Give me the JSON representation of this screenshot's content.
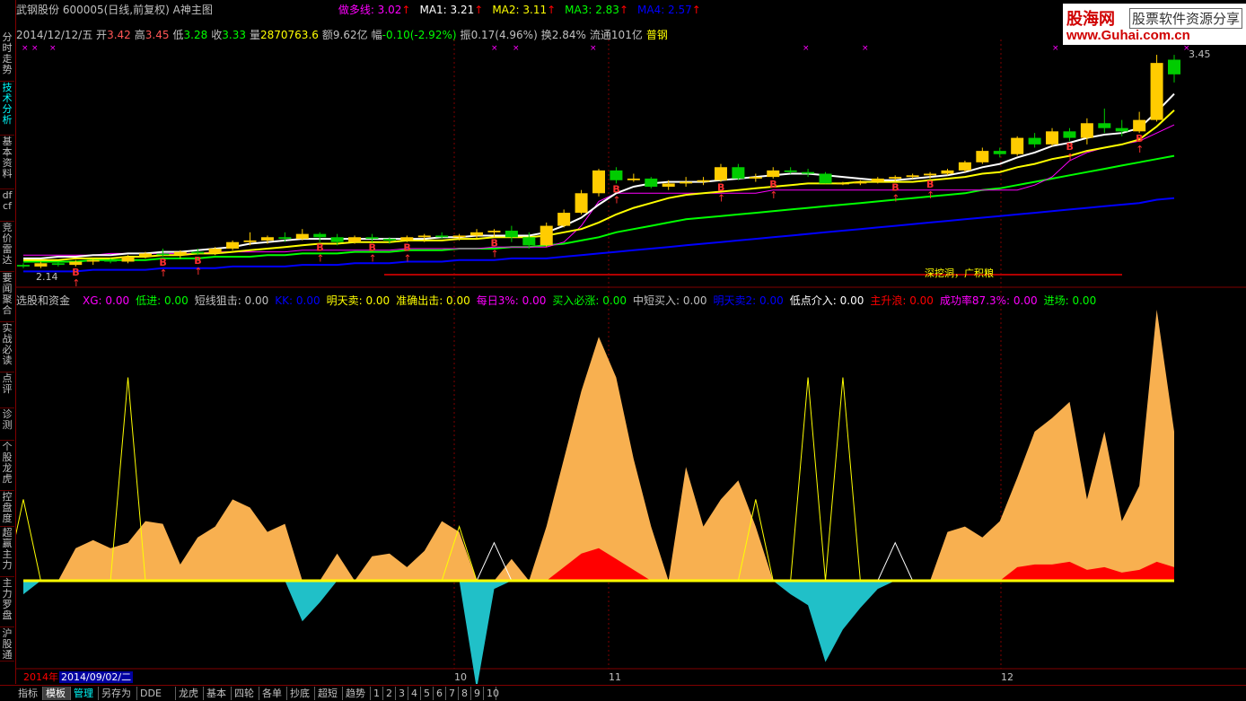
{
  "header": {
    "stock_title": "武钢股份 600005(日线,前复权) A神主图",
    "ma_labels": [
      {
        "text": "做多线: 3.02",
        "color": "#ff00ff"
      },
      {
        "text": "MA1: 3.21",
        "color": "#ffffff"
      },
      {
        "text": "MA2: 3.11",
        "color": "#ffff00"
      },
      {
        "text": "MA3: 2.83",
        "color": "#00ff00"
      },
      {
        "text": "MA4: 2.57",
        "color": "#0000ff"
      }
    ],
    "arrow": "↑"
  },
  "info": {
    "date": "2014/12/12/五",
    "open_label": "开",
    "open": "3.42",
    "high_label": "高",
    "high": "3.45",
    "low_label": "低",
    "low": "3.28",
    "close_label": "收",
    "close": "3.33",
    "volume_label": "量",
    "volume": "2870763.6",
    "amount_label": "额",
    "amount": "9.62亿",
    "change_label": "幅",
    "change": "-0.10(-2.92%)",
    "amp_label": "振",
    "amp": "0.17(4.96%)",
    "turn_label": "换",
    "turn": "2.84%",
    "float_label": "流通",
    "float": "101亿",
    "sector": "普钢"
  },
  "logo": {
    "brand": "股海网",
    "slogan": "股票软件资源分享",
    "url": "www.Guhai.com.cn"
  },
  "sidebar": [
    {
      "label": "分时走势",
      "active": false
    },
    {
      "label": "技术分析",
      "active": true
    },
    {
      "label": "基本资料",
      "active": false
    },
    {
      "label": "dfcf",
      "active": false
    },
    {
      "label": "竞价雷达",
      "active": false
    },
    {
      "label": "要闻聚合",
      "active": false
    },
    {
      "label": "实战必读",
      "active": false
    },
    {
      "label": "点评",
      "active": false
    },
    {
      "label": "诊测",
      "active": false
    },
    {
      "label": "个股龙虎",
      "active": false
    },
    {
      "label": "控盘度",
      "active": false
    },
    {
      "label": "超赢主力",
      "active": false
    },
    {
      "label": "主力罗盘",
      "active": false
    },
    {
      "label": "沪股通",
      "active": false
    }
  ],
  "indicator": {
    "name": "选股和资金",
    "items": [
      {
        "text": "XG: 0.00",
        "color": "#ff00ff"
      },
      {
        "text": "低进: 0.00",
        "color": "#00ff00"
      },
      {
        "text": "短线狙击: 0.00",
        "color": "#c0c0c0"
      },
      {
        "text": "KK: 0.00",
        "color": "#0000ff"
      },
      {
        "text": "明天卖: 0.00",
        "color": "#ffff00"
      },
      {
        "text": "准确出击: 0.00",
        "color": "#ffff00"
      },
      {
        "text": "每日3%: 0.00",
        "color": "#ff00ff"
      },
      {
        "text": "买入必涨: 0.00",
        "color": "#00ff00"
      },
      {
        "text": "中短买入: 0.00",
        "color": "#c0c0c0"
      },
      {
        "text": "明天卖2: 0.00",
        "color": "#0000ff"
      },
      {
        "text": "低点介入: 0.00",
        "color": "#ffffff"
      },
      {
        "text": "主升浪: 0.00",
        "color": "#ff0000"
      },
      {
        "text": "成功率87.3%: 0.00",
        "color": "#ff00ff"
      },
      {
        "text": "进场: 0.00",
        "color": "#00ff00"
      }
    ]
  },
  "annotations": {
    "price_high": "3.45",
    "price_low": "2.14",
    "banner": "深挖洞，广积粮",
    "buy_marker": "B"
  },
  "time_axis": {
    "year": "2014年",
    "cursor_date": "2014/09/02/二",
    "months": [
      "10",
      "11",
      "12"
    ]
  },
  "bottom_tabs": [
    {
      "label": "指标",
      "state": "normal"
    },
    {
      "label": "模板",
      "state": "active"
    },
    {
      "label": "管理",
      "state": "hl"
    },
    {
      "label": "另存为",
      "state": "normal"
    },
    {
      "label": "DDE",
      "state": "normal"
    },
    {
      "label": "龙虎",
      "state": "normal"
    },
    {
      "label": "基本",
      "state": "normal"
    },
    {
      "label": "四轮",
      "state": "normal"
    },
    {
      "label": "各单",
      "state": "normal"
    },
    {
      "label": "抄底",
      "state": "normal"
    },
    {
      "label": "超短",
      "state": "normal"
    },
    {
      "label": "趋势",
      "state": "normal"
    },
    {
      "label": "1",
      "state": "normal"
    },
    {
      "label": "2",
      "state": "normal"
    },
    {
      "label": "3",
      "state": "normal"
    },
    {
      "label": "4",
      "state": "normal"
    },
    {
      "label": "5",
      "state": "normal"
    },
    {
      "label": "6",
      "state": "normal"
    },
    {
      "label": "7",
      "state": "normal"
    },
    {
      "label": "8",
      "state": "normal"
    },
    {
      "label": "9",
      "state": "normal"
    },
    {
      "label": "10",
      "state": "normal"
    }
  ],
  "chart_data": {
    "type": "candlestick",
    "ylim": [
      2.1,
      3.5
    ],
    "candles": [
      [
        2.16,
        2.17,
        2.14,
        2.15
      ],
      [
        2.15,
        2.18,
        2.14,
        2.17
      ],
      [
        2.17,
        2.18,
        2.15,
        2.16
      ],
      [
        2.16,
        2.19,
        2.15,
        2.18
      ],
      [
        2.18,
        2.2,
        2.16,
        2.19
      ],
      [
        2.19,
        2.2,
        2.17,
        2.18
      ],
      [
        2.18,
        2.22,
        2.17,
        2.21
      ],
      [
        2.21,
        2.24,
        2.2,
        2.23
      ],
      [
        2.23,
        2.26,
        2.21,
        2.22
      ],
      [
        2.22,
        2.25,
        2.2,
        2.24
      ],
      [
        2.24,
        2.26,
        2.22,
        2.23
      ],
      [
        2.23,
        2.27,
        2.22,
        2.26
      ],
      [
        2.26,
        2.31,
        2.25,
        2.3
      ],
      [
        2.3,
        2.36,
        2.28,
        2.31
      ],
      [
        2.31,
        2.34,
        2.29,
        2.33
      ],
      [
        2.33,
        2.36,
        2.3,
        2.32
      ],
      [
        2.32,
        2.38,
        2.31,
        2.35
      ],
      [
        2.35,
        2.36,
        2.3,
        2.33
      ],
      [
        2.33,
        2.35,
        2.28,
        2.3
      ],
      [
        2.3,
        2.34,
        2.29,
        2.33
      ],
      [
        2.33,
        2.35,
        2.3,
        2.32
      ],
      [
        2.32,
        2.33,
        2.29,
        2.31
      ],
      [
        2.31,
        2.34,
        2.3,
        2.33
      ],
      [
        2.33,
        2.35,
        2.3,
        2.34
      ],
      [
        2.34,
        2.36,
        2.32,
        2.33
      ],
      [
        2.33,
        2.35,
        2.31,
        2.34
      ],
      [
        2.34,
        2.38,
        2.32,
        2.36
      ],
      [
        2.36,
        2.38,
        2.33,
        2.37
      ],
      [
        2.37,
        2.4,
        2.3,
        2.33
      ],
      [
        2.33,
        2.36,
        2.26,
        2.28
      ],
      [
        2.28,
        2.42,
        2.27,
        2.4
      ],
      [
        2.4,
        2.5,
        2.39,
        2.48
      ],
      [
        2.48,
        2.62,
        2.47,
        2.6
      ],
      [
        2.6,
        2.75,
        2.58,
        2.74
      ],
      [
        2.74,
        2.76,
        2.66,
        2.68
      ],
      [
        2.68,
        2.72,
        2.67,
        2.69
      ],
      [
        2.69,
        2.7,
        2.63,
        2.64
      ],
      [
        2.64,
        2.68,
        2.62,
        2.66
      ],
      [
        2.66,
        2.7,
        2.64,
        2.67
      ],
      [
        2.67,
        2.7,
        2.65,
        2.68
      ],
      [
        2.68,
        2.78,
        2.67,
        2.76
      ],
      [
        2.76,
        2.78,
        2.68,
        2.69
      ],
      [
        2.69,
        2.72,
        2.67,
        2.7
      ],
      [
        2.7,
        2.76,
        2.69,
        2.74
      ],
      [
        2.74,
        2.76,
        2.72,
        2.73
      ],
      [
        2.73,
        2.75,
        2.7,
        2.72
      ],
      [
        2.72,
        2.73,
        2.66,
        2.66
      ],
      [
        2.66,
        2.67,
        2.65,
        2.66
      ],
      [
        2.66,
        2.68,
        2.65,
        2.67
      ],
      [
        2.67,
        2.7,
        2.66,
        2.69
      ],
      [
        2.69,
        2.71,
        2.67,
        2.7
      ],
      [
        2.7,
        2.72,
        2.69,
        2.71
      ],
      [
        2.71,
        2.73,
        2.69,
        2.72
      ],
      [
        2.72,
        2.75,
        2.71,
        2.74
      ],
      [
        2.74,
        2.8,
        2.73,
        2.79
      ],
      [
        2.79,
        2.88,
        2.78,
        2.86
      ],
      [
        2.86,
        2.88,
        2.82,
        2.84
      ],
      [
        2.84,
        2.95,
        2.83,
        2.94
      ],
      [
        2.94,
        2.97,
        2.88,
        2.9
      ],
      [
        2.9,
        3.0,
        2.89,
        2.98
      ],
      [
        2.98,
        3.0,
        2.92,
        2.94
      ],
      [
        2.94,
        3.06,
        2.9,
        3.03
      ],
      [
        3.03,
        3.12,
        2.97,
        3.0
      ],
      [
        3.0,
        3.05,
        2.95,
        2.98
      ],
      [
        2.98,
        3.1,
        2.97,
        3.05
      ],
      [
        3.05,
        3.45,
        3.04,
        3.4
      ],
      [
        3.42,
        3.45,
        3.28,
        3.33
      ]
    ],
    "ma_white": [
      2.2,
      2.2,
      2.21,
      2.21,
      2.22,
      2.22,
      2.23,
      2.23,
      2.24,
      2.24,
      2.25,
      2.26,
      2.27,
      2.29,
      2.3,
      2.31,
      2.32,
      2.32,
      2.32,
      2.32,
      2.32,
      2.32,
      2.32,
      2.32,
      2.33,
      2.33,
      2.34,
      2.34,
      2.34,
      2.34,
      2.36,
      2.4,
      2.45,
      2.53,
      2.6,
      2.64,
      2.66,
      2.67,
      2.67,
      2.67,
      2.68,
      2.69,
      2.7,
      2.71,
      2.72,
      2.72,
      2.71,
      2.7,
      2.69,
      2.68,
      2.68,
      2.69,
      2.7,
      2.71,
      2.73,
      2.76,
      2.78,
      2.82,
      2.85,
      2.89,
      2.91,
      2.94,
      2.96,
      2.97,
      3.0,
      3.1,
      3.21
    ],
    "ma_yellow": [
      2.19,
      2.19,
      2.19,
      2.2,
      2.2,
      2.2,
      2.21,
      2.21,
      2.22,
      2.22,
      2.23,
      2.23,
      2.24,
      2.25,
      2.26,
      2.27,
      2.28,
      2.29,
      2.29,
      2.3,
      2.3,
      2.3,
      2.31,
      2.31,
      2.31,
      2.32,
      2.32,
      2.33,
      2.33,
      2.33,
      2.34,
      2.36,
      2.38,
      2.42,
      2.47,
      2.51,
      2.54,
      2.57,
      2.59,
      2.6,
      2.61,
      2.62,
      2.63,
      2.64,
      2.65,
      2.66,
      2.66,
      2.66,
      2.67,
      2.67,
      2.67,
      2.67,
      2.68,
      2.69,
      2.7,
      2.72,
      2.73,
      2.76,
      2.78,
      2.81,
      2.83,
      2.86,
      2.88,
      2.9,
      2.93,
      3.01,
      3.11
    ],
    "ma_green": [
      2.18,
      2.18,
      2.18,
      2.18,
      2.19,
      2.19,
      2.19,
      2.19,
      2.2,
      2.2,
      2.2,
      2.21,
      2.21,
      2.21,
      2.22,
      2.22,
      2.23,
      2.23,
      2.23,
      2.24,
      2.24,
      2.24,
      2.25,
      2.25,
      2.25,
      2.26,
      2.26,
      2.26,
      2.27,
      2.27,
      2.28,
      2.29,
      2.31,
      2.33,
      2.36,
      2.38,
      2.4,
      2.42,
      2.44,
      2.45,
      2.46,
      2.47,
      2.48,
      2.49,
      2.5,
      2.51,
      2.52,
      2.53,
      2.54,
      2.55,
      2.56,
      2.57,
      2.58,
      2.59,
      2.6,
      2.62,
      2.63,
      2.65,
      2.67,
      2.69,
      2.71,
      2.73,
      2.75,
      2.77,
      2.79,
      2.81,
      2.83
    ],
    "ma_blue": [
      2.12,
      2.12,
      2.12,
      2.12,
      2.13,
      2.13,
      2.13,
      2.13,
      2.14,
      2.14,
      2.14,
      2.14,
      2.15,
      2.15,
      2.15,
      2.15,
      2.16,
      2.16,
      2.16,
      2.17,
      2.17,
      2.17,
      2.18,
      2.18,
      2.18,
      2.19,
      2.19,
      2.19,
      2.2,
      2.2,
      2.2,
      2.21,
      2.22,
      2.23,
      2.24,
      2.25,
      2.26,
      2.27,
      2.28,
      2.29,
      2.3,
      2.31,
      2.32,
      2.33,
      2.34,
      2.35,
      2.36,
      2.37,
      2.38,
      2.39,
      2.4,
      2.41,
      2.42,
      2.43,
      2.44,
      2.45,
      2.46,
      2.47,
      2.48,
      2.49,
      2.5,
      2.51,
      2.52,
      2.53,
      2.54,
      2.56,
      2.57
    ],
    "ma_magenta": [
      2.22,
      2.22,
      2.22,
      2.22,
      2.22,
      2.23,
      2.23,
      2.23,
      2.23,
      2.23,
      2.23,
      2.24,
      2.24,
      2.24,
      2.24,
      2.24,
      2.25,
      2.25,
      2.25,
      2.25,
      2.25,
      2.25,
      2.26,
      2.26,
      2.26,
      2.26,
      2.26,
      2.27,
      2.27,
      2.27,
      2.27,
      2.3,
      2.4,
      2.55,
      2.6,
      2.6,
      2.6,
      2.6,
      2.6,
      2.6,
      2.6,
      2.6,
      2.6,
      2.62,
      2.62,
      2.62,
      2.62,
      2.62,
      2.62,
      2.62,
      2.62,
      2.62,
      2.62,
      2.62,
      2.62,
      2.62,
      2.62,
      2.62,
      2.65,
      2.7,
      2.8,
      2.85,
      2.88,
      2.9,
      2.92,
      2.97,
      3.02
    ],
    "buy_signals": [
      3,
      8,
      10,
      17,
      20,
      22,
      27,
      34,
      40,
      43,
      50,
      52,
      60,
      64
    ],
    "orange_area": [
      0.0,
      0.0,
      0.0,
      0.12,
      0.15,
      0.12,
      0.14,
      0.22,
      0.21,
      0.06,
      0.16,
      0.2,
      0.3,
      0.27,
      0.18,
      0.21,
      0.0,
      0.0,
      0.1,
      0.0,
      0.09,
      0.1,
      0.05,
      0.11,
      0.22,
      0.18,
      0.0,
      0.0,
      0.08,
      0.0,
      0.2,
      0.45,
      0.7,
      0.9,
      0.75,
      0.45,
      0.2,
      0.0,
      0.42,
      0.2,
      0.3,
      0.37,
      0.2,
      0.0,
      0.0,
      0.0,
      0.0,
      0.0,
      0.0,
      0.0,
      0.0,
      0.0,
      0.0,
      0.18,
      0.2,
      0.16,
      0.22,
      0.38,
      0.55,
      0.6,
      0.66,
      0.3,
      0.55,
      0.22,
      0.35,
      1.0,
      0.55
    ],
    "red_area": [
      0,
      0,
      0,
      0,
      0,
      0,
      0,
      0,
      0,
      0,
      0,
      0,
      0,
      0,
      0,
      0,
      0,
      0,
      0,
      0,
      0,
      0,
      0,
      0,
      0,
      0,
      0,
      0,
      0,
      0,
      0,
      0.05,
      0.1,
      0.12,
      0.08,
      0.04,
      0,
      0,
      0,
      0,
      0,
      0,
      0,
      0,
      0,
      0,
      0,
      0,
      0,
      0,
      0,
      0,
      0,
      0,
      0,
      0,
      0,
      0.05,
      0.06,
      0.06,
      0.07,
      0.04,
      0.05,
      0.03,
      0.04,
      0.07,
      0.05
    ],
    "cyan_area": [
      -0.05,
      0.0,
      0,
      0,
      0,
      0,
      0,
      0,
      0,
      0,
      0,
      0,
      0,
      0,
      0,
      0,
      -0.15,
      -0.08,
      0,
      0,
      0,
      0,
      0,
      0,
      0,
      0,
      -0.4,
      -0.03,
      0,
      0,
      0,
      0,
      0,
      0,
      0,
      0,
      0,
      0,
      0,
      0,
      0,
      0,
      0,
      0,
      -0.05,
      -0.09,
      -0.3,
      -0.18,
      -0.1,
      -0.03,
      0,
      0,
      0,
      0,
      0,
      0,
      0,
      0,
      0,
      0,
      0,
      0,
      0,
      0,
      0,
      0,
      0
    ],
    "yellow_spikes": [
      [
        0,
        0.3
      ],
      [
        6,
        0.75
      ],
      [
        25,
        0.2
      ],
      [
        42,
        0.3
      ],
      [
        45,
        0.75
      ],
      [
        47,
        0.75
      ]
    ],
    "white_spikes": [
      [
        27,
        0.14
      ],
      [
        50,
        0.14
      ]
    ]
  }
}
